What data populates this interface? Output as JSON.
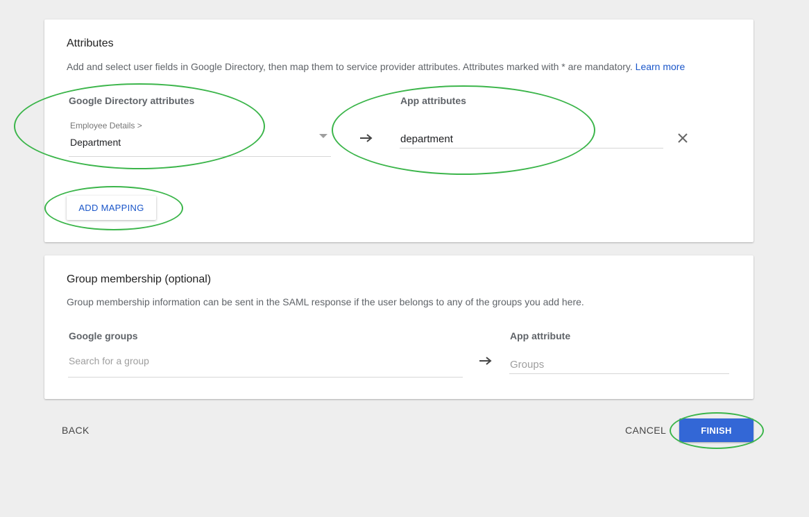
{
  "attributes_section": {
    "title": "Attributes",
    "description": "Add and select user fields in Google Directory, then map them to service provider attributes. Attributes marked with * are mandatory.",
    "learn_more": "Learn more",
    "google_directory_header": "Google Directory attributes",
    "app_attributes_header": "App attributes",
    "mapping": {
      "category": "Employee Details >",
      "field": "Department",
      "app_attribute_value": "department"
    },
    "add_mapping_label": "ADD MAPPING"
  },
  "group_section": {
    "title": "Group membership (optional)",
    "description": "Group membership information can be sent in the SAML response if the user belongs to any of the groups you add here.",
    "google_groups_header": "Google groups",
    "search_placeholder": "Search for a group",
    "app_attribute_header": "App attribute",
    "app_attribute_placeholder": "Groups"
  },
  "footer": {
    "back_label": "BACK",
    "cancel_label": "CANCEL",
    "finish_label": "FINISH"
  },
  "icons": {
    "arrow": "arrow-right-icon",
    "remove": "close-icon",
    "dropdown": "dropdown-caret-icon"
  },
  "colors": {
    "accent": "#3367d6",
    "link": "#1a56c9",
    "annotation": "#3bb54a",
    "background": "#eeeeee"
  }
}
